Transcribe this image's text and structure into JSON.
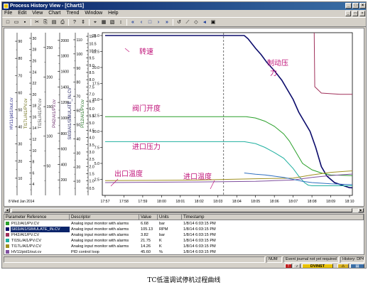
{
  "window": {
    "title": "Process History View - [Chart1]",
    "caption_buttons": [
      "_",
      "□",
      "×"
    ]
  },
  "menu": [
    "File",
    "Edit",
    "View",
    "Chart",
    "Trend",
    "Window",
    "Help"
  ],
  "mdi_buttons": [
    "_",
    "□",
    "×"
  ],
  "toolbar": {
    "buttons": [
      {
        "glyph": "□",
        "icon": "new-icon"
      },
      {
        "glyph": "▭",
        "icon": "open-icon"
      },
      {
        "glyph": "▪",
        "icon": "save-icon"
      },
      {
        "glyph": "✂",
        "icon": "cut-icon"
      },
      {
        "glyph": "⎘",
        "icon": "copy-icon"
      },
      {
        "glyph": "▤",
        "icon": "paste-icon"
      },
      {
        "glyph": "⎙",
        "icon": "print-icon"
      },
      {
        "glyph": "?",
        "icon": "help-icon"
      },
      {
        "glyph": "⇕",
        "icon": "stack-icon"
      },
      {
        "glyph": "⌖",
        "icon": "cursor-icon"
      },
      {
        "glyph": "▦",
        "icon": "grid-icon"
      },
      {
        "glyph": "▧",
        "icon": "table-icon"
      },
      {
        "glyph": "↕",
        "icon": "scale-icon"
      },
      {
        "glyph": "«",
        "icon": "page-back-icon"
      },
      {
        "glyph": "‹",
        "icon": "scroll-back-icon"
      },
      {
        "glyph": "□",
        "icon": "stop-icon"
      },
      {
        "glyph": "›",
        "icon": "scroll-forward-icon"
      },
      {
        "glyph": "»",
        "icon": "page-forward-icon"
      },
      {
        "glyph": "↺",
        "icon": "refresh-icon"
      },
      {
        "glyph": "⟋",
        "icon": "trend-icon"
      },
      {
        "glyph": "◇",
        "icon": "marker-icon"
      },
      {
        "glyph": "◂",
        "icon": "zoom-out-icon"
      },
      {
        "glyph": "▣",
        "icon": "zoom-box-icon"
      }
    ]
  },
  "chart_data": {
    "type": "line",
    "x_ticks": [
      "17:57",
      "17:58",
      "17:59",
      "18:00",
      "18:01",
      "18:02",
      "18:03",
      "18:04",
      "18:05",
      "18:06",
      "18:07",
      "18:08",
      "18:09",
      "18:10"
    ],
    "main_axis": {
      "ticks": [
        "2.5",
        "5.0",
        "7.5",
        "10.0",
        "12.5",
        "15.0",
        "17.5",
        "20.0",
        "22.5",
        "25.0"
      ],
      "range": [
        0,
        25
      ]
    },
    "side_axes": [
      {
        "label": "HV11/pid1/out.cv",
        "color": "#2a2a8a",
        "ticks": [
          "10",
          "20",
          "30",
          "40",
          "50",
          "60",
          "70",
          "80",
          "90"
        ],
        "range": [
          0,
          100
        ]
      },
      {
        "label": "TI17L/AI1/PV.cv",
        "color": "#6a6a10",
        "ticks": [
          "4",
          "6",
          "8",
          "10",
          "12",
          "14",
          "16",
          "18",
          "20",
          "22",
          "24",
          "26",
          "28",
          "30"
        ],
        "range": [
          0,
          30
        ]
      },
      {
        "label": "TI15L/AI1/PV.cv",
        "color": "#4a4a4a",
        "ticks": [
          "50",
          "100",
          "150",
          "200",
          "250"
        ],
        "range": [
          0,
          275
        ]
      },
      {
        "label": "PI42/AI1/PV.cv",
        "color": "#6a2a6a",
        "ticks": [
          "200",
          "400",
          "600",
          "800",
          "1000",
          "1200",
          "1400",
          "1600",
          "1800",
          "2000"
        ],
        "range": [
          0,
          2100
        ]
      },
      {
        "label": "SI03/AI1/SIMULATE_IN.CV",
        "color": "#1c1c5c",
        "ticks": [
          "10",
          "20",
          "30",
          "40",
          "50",
          "60",
          "70",
          "80",
          "90",
          "100",
          "110"
        ],
        "range": [
          0,
          115
        ]
      },
      {
        "label": "PI12/AI1/PV.cv",
        "color": "#1c6c1c",
        "ticks": [
          "0.5",
          "1.0",
          "1.5",
          "2.0",
          "2.5",
          "3.0",
          "3.5",
          "4.0",
          "4.5",
          "5.0",
          "5.5",
          "6.0",
          "6.5",
          "7.0",
          "7.5",
          "8.0",
          "8.5",
          "9.0",
          "9.5",
          "10.0",
          "10.5",
          "11.0"
        ],
        "range": [
          0,
          11.3
        ]
      }
    ],
    "cursor_time": "18:03",
    "series": [
      {
        "name": "SI03/AI1/SIMULATE_IN.CV",
        "color": "#0b0b6b",
        "x": [
          0,
          3.5,
          7.4,
          7.6,
          8.0,
          8.3,
          8.6,
          9.0,
          9.4,
          9.7,
          10.0,
          10.3,
          10.6,
          10.9,
          11.2,
          11.5,
          11.8,
          12.2,
          12.6,
          13.0,
          13.9
        ],
        "y": [
          25.0,
          25.0,
          25.0,
          24.5,
          23.0,
          22.0,
          20.8,
          19.5,
          18.0,
          16.5,
          15.0,
          13.0,
          11.5,
          10.0,
          7.5,
          4.5,
          3.0,
          2.0,
          1.6,
          1.2,
          1.1
        ]
      },
      {
        "name": "PI42/AI1/PV.cv",
        "color": "#a0305a",
        "x": [
          0,
          10.2,
          10.8,
          11.0,
          11.1,
          11.15,
          11.5,
          12.5,
          13.9
        ],
        "y": [
          32,
          32,
          32,
          32,
          31,
          17.0,
          16.0,
          15.8,
          15.8
        ]
      },
      {
        "name": "PI12/AI1/PV.cv",
        "color": "#2aa02a",
        "x": [
          0,
          7.0,
          7.5,
          8.0,
          8.5,
          9.0,
          9.5,
          9.8,
          10.0,
          10.5,
          11.0,
          11.5,
          12.0,
          13.9
        ],
        "y": [
          12.3,
          12.3,
          12.3,
          12.1,
          11.6,
          10.8,
          9.6,
          8.5,
          7.5,
          5.0,
          4.0,
          3.5,
          3.2,
          3.0
        ]
      },
      {
        "name": "TI15L/AI1/PV.cv",
        "color": "#20b0a0",
        "x": [
          0,
          7.4,
          8.0,
          8.5,
          9.0,
          9.5,
          10.0,
          10.3,
          10.6,
          10.8,
          11.0,
          13.9
        ],
        "y": [
          8.4,
          8.4,
          8.1,
          7.5,
          6.7,
          5.8,
          4.2,
          3.0,
          2.0,
          1.6,
          1.5,
          1.5
        ]
      },
      {
        "name": "TI17L/AI1/PV.cv",
        "color": "#a09020",
        "x": [
          0,
          5.0,
          8.0,
          10.0,
          11.0,
          12.0,
          13.0,
          13.9
        ],
        "y": [
          2.3,
          2.4,
          2.6,
          2.7,
          3.2,
          3.6,
          3.8,
          4.0
        ]
      },
      {
        "name": "HV11/pid1/out.cv",
        "color": "#8050a0",
        "x": [
          0,
          5.0,
          8.0,
          9.0,
          10.0,
          11.0,
          12.0,
          13.0,
          13.9
        ],
        "y": [
          2.0,
          2.1,
          2.2,
          2.3,
          2.4,
          2.8,
          3.1,
          3.3,
          3.4
        ]
      },
      {
        "name": "TI17L/AI1/PV.cv",
        "color": "#3070c0",
        "x": [
          7.4,
          8.0,
          8.5,
          9.0,
          9.5,
          10.0,
          10.5,
          11.0,
          11.5,
          12.0,
          13.0,
          13.9
        ],
        "y": [
          3.5,
          3.3,
          3.2,
          3.0,
          2.8,
          2.5,
          2.2,
          2.0,
          1.9,
          1.8,
          1.7,
          1.6
        ]
      }
    ],
    "annotations": [
      "转速",
      "制动压",
      "力",
      "阀门开度",
      "进口压力",
      "出口温度",
      "进口温度"
    ],
    "date_label": "8 Wed Jan 2014",
    "grid": true
  },
  "grid_table": {
    "headers": [
      "Parameter Reference",
      "Descriptor",
      "Value",
      "Units",
      "Timestamp"
    ],
    "rows": [
      {
        "color": "#2aa02a",
        "ref": "PI12/AI1/PV.CV",
        "desc": "Analog input monitor with alarms",
        "value": "6.68",
        "units": "bar",
        "time": "1/8/14 6:03:15 PM"
      },
      {
        "color": "#0b0b6b",
        "ref": "SI03/AI1/SIMULATE_IN.CV",
        "desc": "Analog input monitor with alarms",
        "value": "105.13",
        "units": "RPM",
        "time": "1/8/14 6:03:15 PM"
      },
      {
        "color": "#a0305a",
        "ref": "PI42/AI1/PV.CV",
        "desc": "Analog input monitor with alarms",
        "value": "3.82",
        "units": "bar",
        "time": "1/8/14 6:03:15 PM"
      },
      {
        "color": "#20b0a0",
        "ref": "TI15L/AI1/PV.CV",
        "desc": "Analog input monitor with alarms",
        "value": "21.75",
        "units": "K",
        "time": "1/8/14 6:03:15 PM"
      },
      {
        "color": "#a09020",
        "ref": "TI17L/AI1/PV.CV",
        "desc": "Analog input monitor with alarms",
        "value": "14.26",
        "units": "K",
        "time": "1/8/14 6:03:15 PM"
      },
      {
        "color": "#8050a0",
        "ref": "HV11/pid1/out.cv",
        "desc": "PID control loop",
        "value": "45.60",
        "units": "%",
        "time": "1/8/14 6:03:15 PM"
      }
    ]
  },
  "status": {
    "num": "NUM",
    "journal": "Event journal not yet required",
    "history": "History: DP4"
  },
  "taskbar": {
    "user": "DVINST",
    "red_icon": "red-alarm-icon",
    "yellow_icon": "yellow-alarm-icon"
  },
  "caption": "TC低温调试停机过程曲线"
}
